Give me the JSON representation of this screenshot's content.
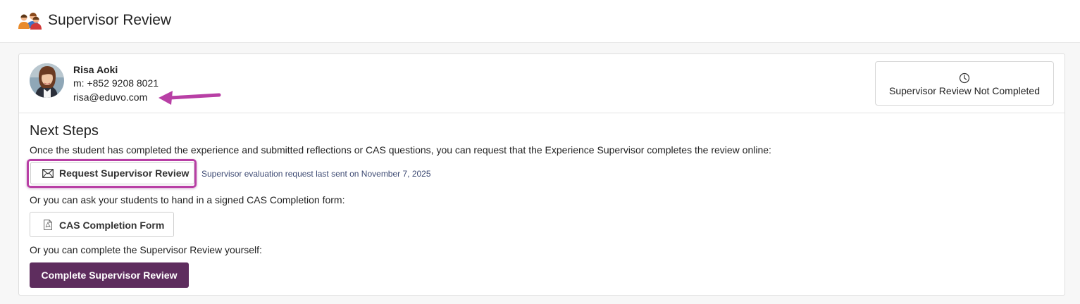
{
  "header": {
    "title": "Supervisor Review",
    "icon": "users-icon"
  },
  "contact": {
    "name": "Risa Aoki",
    "phone": "m: +852 9208 8021",
    "email": "risa@eduvo.com"
  },
  "status": {
    "icon": "clock-icon",
    "text": "Supervisor Review Not Completed"
  },
  "next_steps": {
    "title": "Next Steps",
    "description": "Once the student has completed the experience and submitted reflections or CAS questions, you can request that the Experience Supervisor completes the review online:",
    "request_button": "Request Supervisor Review",
    "last_sent": "Supervisor evaluation request last sent on November 7, 2025",
    "or_form_text": "Or you can ask your students to hand in a signed CAS Completion form:",
    "form_button": "CAS Completion Form",
    "or_self_text": "Or you can complete the Supervisor Review yourself:",
    "complete_button": "Complete Supervisor Review"
  },
  "colors": {
    "primary_button": "#5e2d5e",
    "highlight": "#b83fa5",
    "muted_link_text": "#3d4a73"
  }
}
